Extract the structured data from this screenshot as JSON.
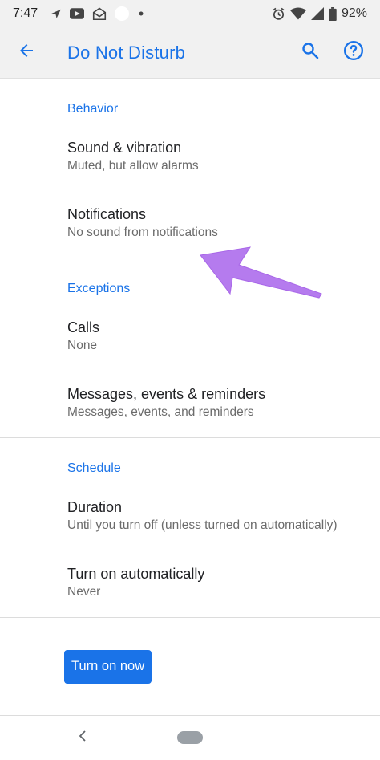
{
  "status_bar": {
    "time": "7:47",
    "battery": "92%",
    "icons": [
      "navigation-icon",
      "youtube-icon",
      "email-icon",
      "circle-icon",
      "dot-icon",
      "alarm-icon",
      "wifi-icon",
      "signal-icon",
      "battery-icon"
    ]
  },
  "app_bar": {
    "title": "Do Not Disturb",
    "back_icon": "back-arrow-icon",
    "search_icon": "search-icon",
    "help_icon": "help-icon",
    "accent_color": "#1a73e8"
  },
  "sections": [
    {
      "header": "Behavior",
      "items": [
        {
          "title": "Sound & vibration",
          "summary": "Muted, but allow alarms"
        },
        {
          "title": "Notifications",
          "summary": "No sound from notifications"
        }
      ]
    },
    {
      "header": "Exceptions",
      "items": [
        {
          "title": "Calls",
          "summary": "None"
        },
        {
          "title": "Messages, events & reminders",
          "summary": "Messages, events, and reminders"
        }
      ]
    },
    {
      "header": "Schedule",
      "items": [
        {
          "title": "Duration",
          "summary": "Until you turn off (unless turned on automatically)"
        },
        {
          "title": "Turn on automatically",
          "summary": "Never"
        }
      ]
    }
  ],
  "turn_on_button": {
    "label": "Turn on now"
  },
  "annotation": {
    "color": "#b57bee"
  }
}
